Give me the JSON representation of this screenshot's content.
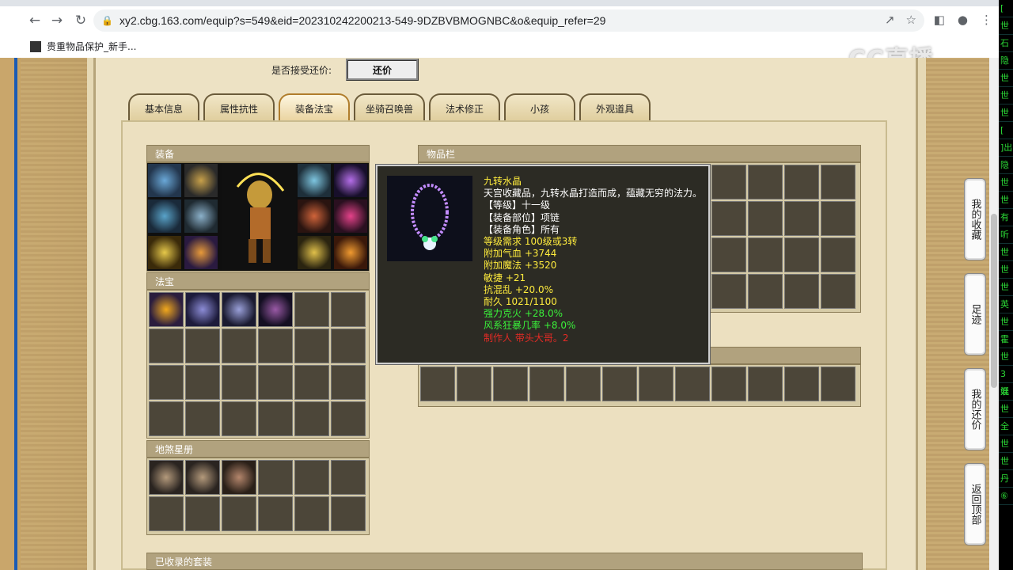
{
  "browser": {
    "url": "xy2.cbg.163.com/equip?s=549&eid=202310242200213-549-9DZBVBMOGNBC&o&equip_refer=29",
    "bookmark": "贵重物品保护_新手..."
  },
  "watermark": "CC直播",
  "counter_offer": {
    "label": "是否接受还价:",
    "button": "还价"
  },
  "tabs": [
    "基本信息",
    "属性抗性",
    "装备法宝",
    "坐骑召唤兽",
    "法术修正",
    "小孩",
    "外观道具"
  ],
  "active_tab": 2,
  "sections": {
    "equipment": "装备",
    "treasure": "法宝",
    "star_book": "地煞星册",
    "inventory": "物品栏",
    "collected_sets": "已收录的套装"
  },
  "tooltip": {
    "name": "九转水晶",
    "description": "天宫收藏品，九转水晶打造而成，蕴藏无穷的法力。",
    "level": "【等级】十一级",
    "slot": "【装备部位】项链",
    "role": "【装备角色】所有",
    "requirement": "等级需求 100级或3转",
    "hp": "附加气血 +3744",
    "mp": "附加魔法 +3520",
    "agility": "敏捷 +21",
    "anti_chaos": "抗混乱 +20.0%",
    "durability": "耐久 1021/1100",
    "fire": "强力克火 +28.0%",
    "wind": "风系狂暴几率 +8.0%",
    "maker": "制作人 带头大哥。2"
  },
  "side_buttons": {
    "favorites": "我的收藏",
    "history": "足迹",
    "my_offers": "我的还价",
    "back_top": "返回顶部"
  },
  "chat_strip": [
    "[",
    "世",
    "石",
    "隐",
    "世",
    "世",
    "世",
    "[",
    "]出",
    "隐",
    "世",
    "世",
    "有",
    "听",
    "世",
    "世",
    "世",
    "英",
    "世",
    "霍",
    "世",
    "3混",
    "妖",
    "世",
    "全",
    "世",
    "世",
    "丹",
    "⑥"
  ]
}
